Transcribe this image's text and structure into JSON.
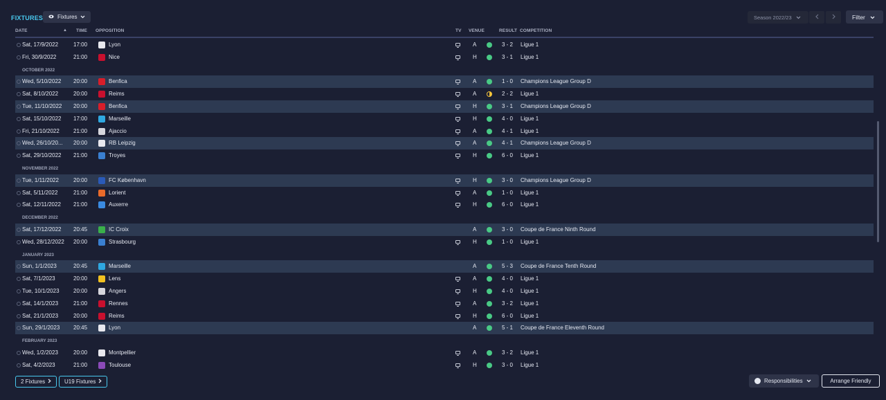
{
  "header": {
    "title": "FIXTURES",
    "view_label": "Fixtures",
    "season_label": "Season 2022/23",
    "filter_label": "Filter"
  },
  "columns": {
    "date": "DATE",
    "time": "TIME",
    "opposition": "OPPOSITION",
    "tv": "TV",
    "venue": "VENUE",
    "result": "RESULT",
    "competition": "COMPETITION"
  },
  "rows": [
    {
      "type": "fixture",
      "date": "Sat, 17/9/2022",
      "time": "17:00",
      "opp": "Lyon",
      "crest": "#e8e8ee",
      "tv": true,
      "venue": "A",
      "result": "win",
      "score": "3 - 2",
      "comp": "Ligue 1",
      "highlight": false
    },
    {
      "type": "fixture",
      "date": "Fri, 30/9/2022",
      "time": "21:00",
      "opp": "Nice",
      "crest": "#c8102e",
      "tv": true,
      "venue": "H",
      "result": "win",
      "score": "3 - 1",
      "comp": "Ligue 1",
      "highlight": false
    },
    {
      "type": "month",
      "label": "OCTOBER 2022"
    },
    {
      "type": "fixture",
      "date": "Wed, 5/10/2022",
      "time": "20:00",
      "opp": "Benfica",
      "crest": "#d81e2a",
      "tv": true,
      "venue": "A",
      "result": "win",
      "score": "1 - 0",
      "comp": "Champions League Group D",
      "highlight": true
    },
    {
      "type": "fixture",
      "date": "Sat, 8/10/2022",
      "time": "20:00",
      "opp": "Reims",
      "crest": "#c8102e",
      "tv": true,
      "venue": "A",
      "result": "draw",
      "score": "2 - 2",
      "comp": "Ligue 1",
      "highlight": false
    },
    {
      "type": "fixture",
      "date": "Tue, 11/10/2022",
      "time": "20:00",
      "opp": "Benfica",
      "crest": "#d81e2a",
      "tv": true,
      "venue": "H",
      "result": "win",
      "score": "3 - 1",
      "comp": "Champions League Group D",
      "highlight": true
    },
    {
      "type": "fixture",
      "date": "Sat, 15/10/2022",
      "time": "17:00",
      "opp": "Marseille",
      "crest": "#2fa8e0",
      "tv": true,
      "venue": "H",
      "result": "win",
      "score": "4 - 0",
      "comp": "Ligue 1",
      "highlight": false
    },
    {
      "type": "fixture",
      "date": "Fri, 21/10/2022",
      "time": "21:00",
      "opp": "Ajaccio",
      "crest": "#d6d6dc",
      "tv": true,
      "venue": "A",
      "result": "win",
      "score": "4 - 1",
      "comp": "Ligue 1",
      "highlight": false
    },
    {
      "type": "fixture",
      "date": "Wed, 26/10/20...",
      "time": "20:00",
      "opp": "RB Leipzig",
      "crest": "#e8e8ee",
      "tv": true,
      "venue": "A",
      "result": "win",
      "score": "4 - 1",
      "comp": "Champions League Group D",
      "highlight": true
    },
    {
      "type": "fixture",
      "date": "Sat, 29/10/2022",
      "time": "21:00",
      "opp": "Troyes",
      "crest": "#3a7fd0",
      "tv": true,
      "venue": "H",
      "result": "win",
      "score": "6 - 0",
      "comp": "Ligue 1",
      "highlight": false
    },
    {
      "type": "month",
      "label": "NOVEMBER 2022"
    },
    {
      "type": "fixture",
      "date": "Tue, 1/11/2022",
      "time": "20:00",
      "opp": "FC København",
      "crest": "#2a5ab8",
      "tv": true,
      "venue": "H",
      "result": "win",
      "score": "3 - 0",
      "comp": "Champions League Group D",
      "highlight": true
    },
    {
      "type": "fixture",
      "date": "Sat, 5/11/2022",
      "time": "21:00",
      "opp": "Lorient",
      "crest": "#e86a2a",
      "tv": true,
      "venue": "A",
      "result": "win",
      "score": "1 - 0",
      "comp": "Ligue 1",
      "highlight": false
    },
    {
      "type": "fixture",
      "date": "Sat, 12/11/2022",
      "time": "21:00",
      "opp": "Auxerre",
      "crest": "#3a8ae0",
      "tv": true,
      "venue": "H",
      "result": "win",
      "score": "6 - 0",
      "comp": "Ligue 1",
      "highlight": false
    },
    {
      "type": "month",
      "label": "DECEMBER 2022"
    },
    {
      "type": "fixture",
      "date": "Sat, 17/12/2022",
      "time": "20:45",
      "opp": "IC Croix",
      "crest": "#3ab04a",
      "tv": false,
      "venue": "A",
      "result": "win",
      "score": "3 - 0",
      "comp": "Coupe de France Ninth Round",
      "highlight": true
    },
    {
      "type": "fixture",
      "date": "Wed, 28/12/2022",
      "time": "20:00",
      "opp": "Strasbourg",
      "crest": "#3a7fd0",
      "tv": true,
      "venue": "H",
      "result": "win",
      "score": "1 - 0",
      "comp": "Ligue 1",
      "highlight": false
    },
    {
      "type": "month",
      "label": "JANUARY 2023"
    },
    {
      "type": "fixture",
      "date": "Sun, 1/1/2023",
      "time": "20:45",
      "opp": "Marseille",
      "crest": "#2fa8e0",
      "tv": false,
      "venue": "A",
      "result": "win",
      "score": "5 - 3",
      "comp": "Coupe de France Tenth Round",
      "highlight": true
    },
    {
      "type": "fixture",
      "date": "Sat, 7/1/2023",
      "time": "20:00",
      "opp": "Lens",
      "crest": "#f0c020",
      "tv": true,
      "venue": "A",
      "result": "win",
      "score": "4 - 0",
      "comp": "Ligue 1",
      "highlight": false
    },
    {
      "type": "fixture",
      "date": "Tue, 10/1/2023",
      "time": "20:00",
      "opp": "Angers",
      "crest": "#d6d6dc",
      "tv": true,
      "venue": "H",
      "result": "win",
      "score": "4 - 0",
      "comp": "Ligue 1",
      "highlight": false
    },
    {
      "type": "fixture",
      "date": "Sat, 14/1/2023",
      "time": "21:00",
      "opp": "Rennes",
      "crest": "#c8102e",
      "tv": true,
      "venue": "A",
      "result": "win",
      "score": "3 - 2",
      "comp": "Ligue 1",
      "highlight": false
    },
    {
      "type": "fixture",
      "date": "Sat, 21/1/2023",
      "time": "20:00",
      "opp": "Reims",
      "crest": "#c8102e",
      "tv": true,
      "venue": "H",
      "result": "win",
      "score": "6 - 0",
      "comp": "Ligue 1",
      "highlight": false
    },
    {
      "type": "fixture",
      "date": "Sun, 29/1/2023",
      "time": "20:45",
      "opp": "Lyon",
      "crest": "#e8e8ee",
      "tv": false,
      "venue": "A",
      "result": "win",
      "score": "5 - 1",
      "comp": "Coupe de France Eleventh Round",
      "highlight": true
    },
    {
      "type": "month",
      "label": "FEBRUARY 2023"
    },
    {
      "type": "fixture",
      "date": "Wed, 1/2/2023",
      "time": "20:00",
      "opp": "Montpellier",
      "crest": "#e8e8ee",
      "tv": true,
      "venue": "A",
      "result": "win",
      "score": "3 - 2",
      "comp": "Ligue 1",
      "highlight": false
    },
    {
      "type": "fixture",
      "date": "Sat, 4/2/2023",
      "time": "21:00",
      "opp": "Toulouse",
      "crest": "#8a4ab8",
      "tv": true,
      "venue": "H",
      "result": "win",
      "score": "3 - 0",
      "comp": "Ligue 1",
      "highlight": false
    }
  ],
  "footer": {
    "fixtures_label": "2 Fixtures",
    "u19_label": "U19 Fixtures",
    "responsibilities_label": "Responsibilities",
    "arrange_label": "Arrange Friendly"
  },
  "colors": {
    "accent": "#49c9ef",
    "win": "#49c985",
    "draw": "#f3c23a",
    "background": "#1b1f33",
    "highlight_row": "#2d3a52"
  }
}
